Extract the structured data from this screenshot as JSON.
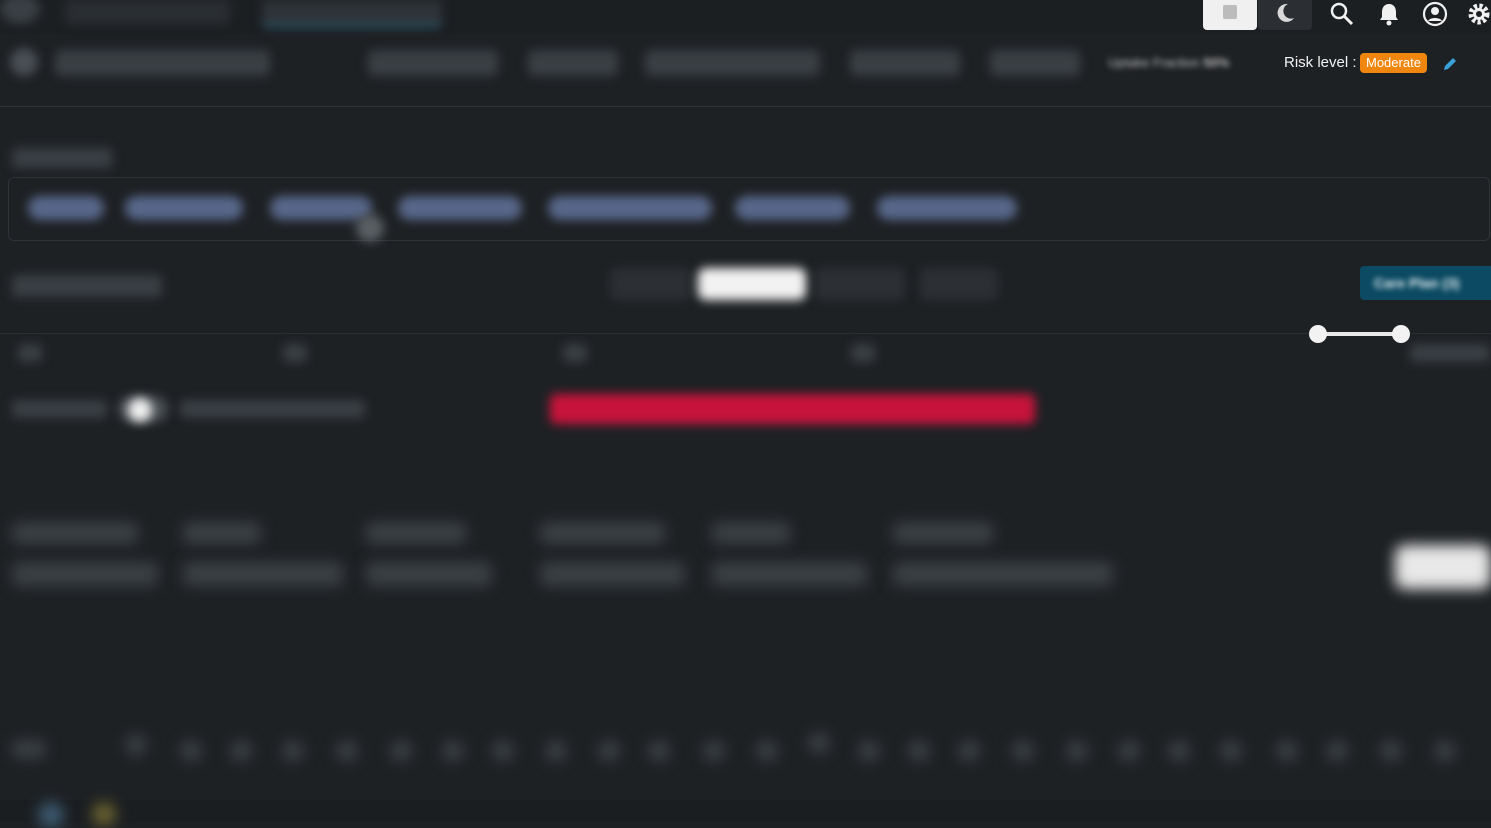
{
  "header": {
    "uptake_fraction_label": "Uptake Fraction",
    "uptake_fraction_value": "50%",
    "risk_level_label": "Risk level :",
    "risk_level_value": "Moderate",
    "risk_level_color": "#f0860e"
  },
  "actions": {
    "care_plan_label": "Care Plan (3)"
  },
  "toolbar": {
    "icons": [
      "light-theme-icon",
      "moon-icon",
      "search-icon",
      "bell-icon",
      "user-icon",
      "gear-icon"
    ]
  },
  "colors": {
    "background": "#1e2124",
    "accent_red": "#c8143c",
    "care_plan_bg": "#0b4a62",
    "chip_bg": "#58678a"
  }
}
